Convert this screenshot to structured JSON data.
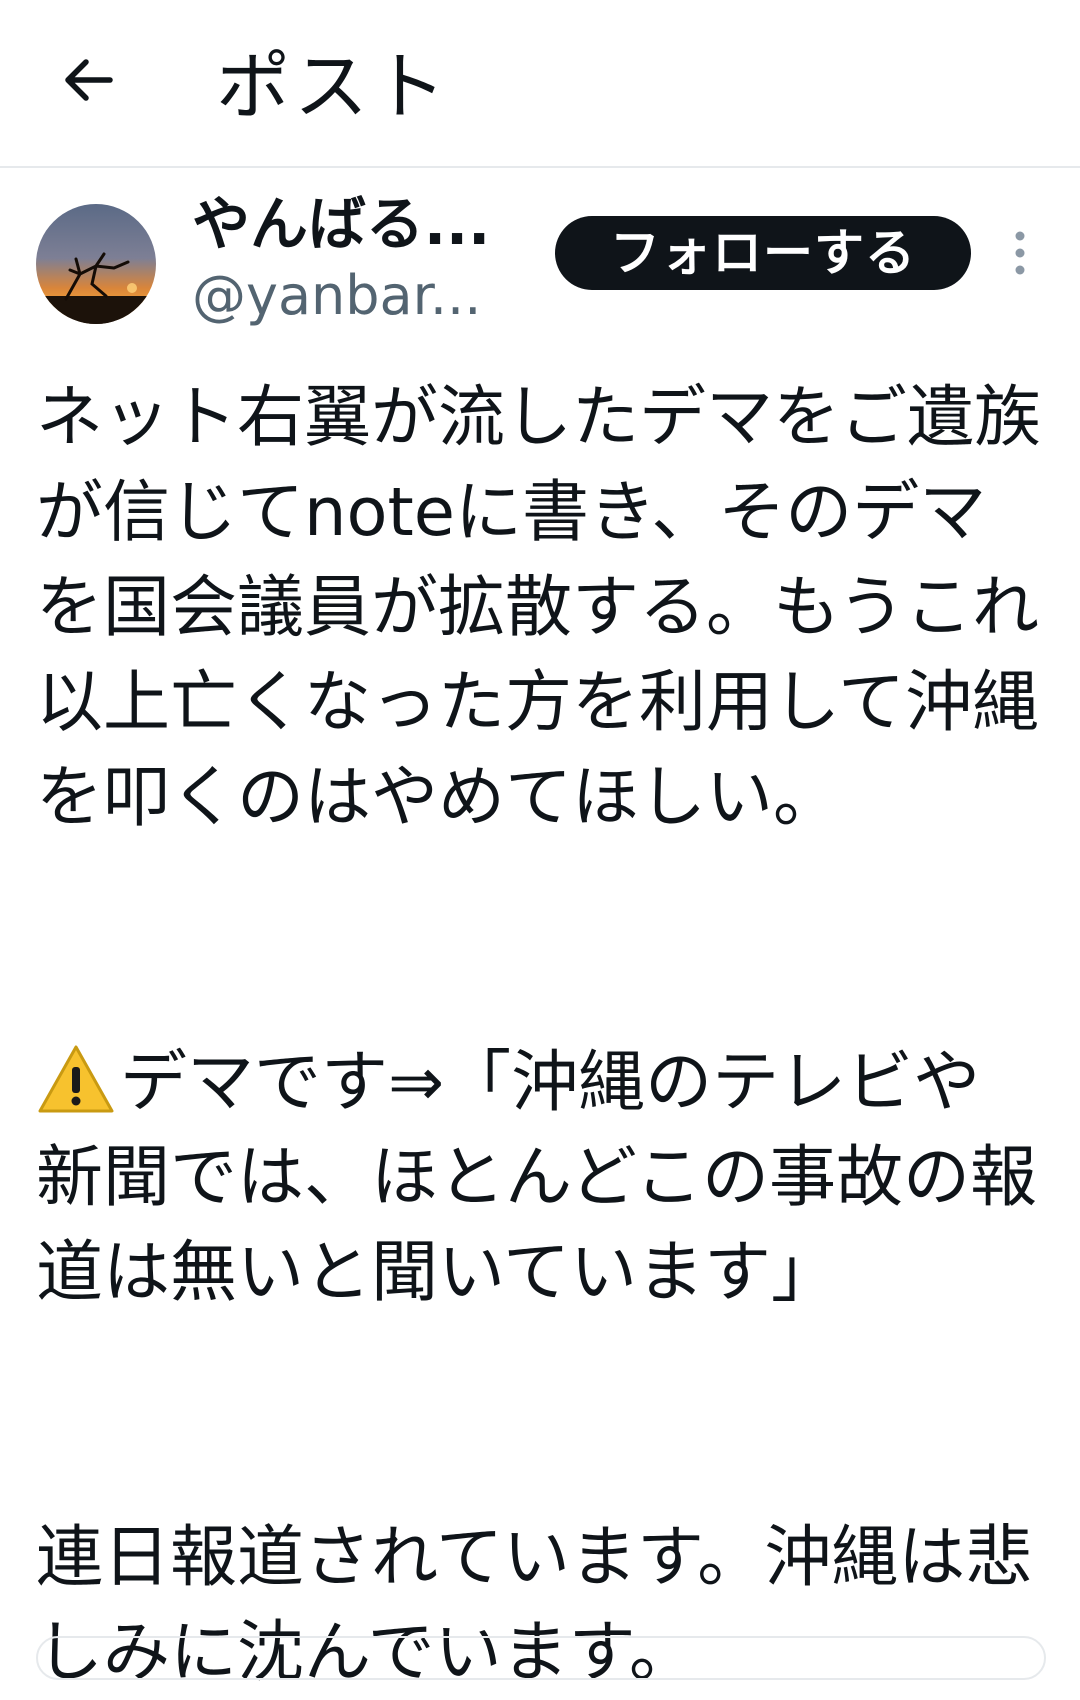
{
  "header": {
    "title": "ポスト",
    "back_icon": "arrow-left-icon"
  },
  "author": {
    "display_name": "やんばる...",
    "handle": "@yanbar...",
    "follow_label": "フォローする",
    "more_icon": "vertical-ellipsis-icon"
  },
  "post": {
    "paragraphs": [
      "ネット右翼が流したデマをご遺族が信じてnoteに書き、そのデマを国会議員が拡散する。もうこれ以上亡くなった方を利用して沖縄を叩くのはやめてほしい。",
      "デマです⇒「沖縄のテレビや新聞では、ほとんどこの事故の報道は無いと聞いています」",
      "連日報道されています。沖縄は悲しみに沈んでいます。"
    ],
    "warning_icon": "warning-icon"
  },
  "colors": {
    "text": "#0f1419",
    "muted": "#536471",
    "button_bg": "#0f1419",
    "divider": "#e6e9ec"
  }
}
